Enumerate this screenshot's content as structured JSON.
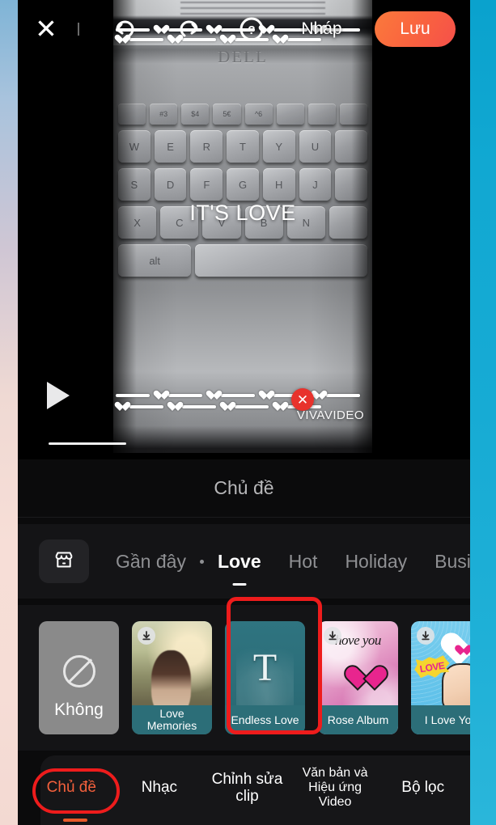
{
  "app": {
    "name": "VivaVideo Editor",
    "accent_orange": "#f4603c",
    "accent_red": "#ee1c1c",
    "teal_label": "#2c6e78",
    "panel_bg": "#141416"
  },
  "topbar": {
    "close_icon": "close-x-icon",
    "undo_icon": "undo-arrow-icon",
    "redo_icon": "redo-arrow-icon",
    "help_icon": "question-mark-icon",
    "draft_label": "Nháp",
    "save_label": "Lưu"
  },
  "preview": {
    "caption_text": "IT'S LOVE",
    "watermark_text": "VIVAVIDEO",
    "watermark_close_icon": "close-circle-icon",
    "play_icon": "play-triangle-icon",
    "brand_on_device": "DELL",
    "keyboard_rows": [
      [
        "",
        "#\n3",
        "$\n4",
        "5 €",
        "^\n6",
        "",
        "",
        ""
      ],
      [
        "W",
        "E",
        "R",
        "T",
        "Y",
        "U",
        ""
      ],
      [
        "S",
        "D",
        "F",
        "G",
        "H",
        "J",
        ""
      ],
      [
        "X",
        "C",
        "V",
        "B",
        "N",
        ""
      ],
      [
        "alt",
        "",
        ""
      ]
    ]
  },
  "panel": {
    "title": "Chủ đề",
    "store_icon": "store-shop-icon",
    "tabs": [
      {
        "label": "Gần đây",
        "active": false
      },
      {
        "label": "Love",
        "active": true
      },
      {
        "label": "Hot",
        "active": false
      },
      {
        "label": "Holiday",
        "active": false
      },
      {
        "label": "Busine",
        "active": false
      }
    ],
    "themes": [
      {
        "label": "Không",
        "kind": "none",
        "selected": false,
        "downloadable": false
      },
      {
        "label": "Love Memories",
        "kind": "memories",
        "selected": false,
        "downloadable": true
      },
      {
        "label": "Endless  Love",
        "kind": "endless",
        "selected": true,
        "downloadable": false
      },
      {
        "label": "Rose Album",
        "kind": "rose",
        "selected": false,
        "downloadable": true,
        "art_text": "hove you"
      },
      {
        "label": "I Love You",
        "kind": "iloveyou",
        "selected": false,
        "downloadable": true,
        "art_text": "LOVE"
      },
      {
        "label": "",
        "kind": "partial",
        "selected": false,
        "downloadable": false
      }
    ]
  },
  "bottomnav": {
    "items": [
      {
        "label": "Chủ đề",
        "active": true,
        "small": false
      },
      {
        "label": "Nhạc",
        "active": false,
        "small": false
      },
      {
        "label": "Chỉnh sửa clip",
        "active": false,
        "small": false
      },
      {
        "label": "Văn bản và Hiệu ứng Video",
        "active": false,
        "small": true
      },
      {
        "label": "Bộ lọc",
        "active": false,
        "small": false
      }
    ]
  }
}
